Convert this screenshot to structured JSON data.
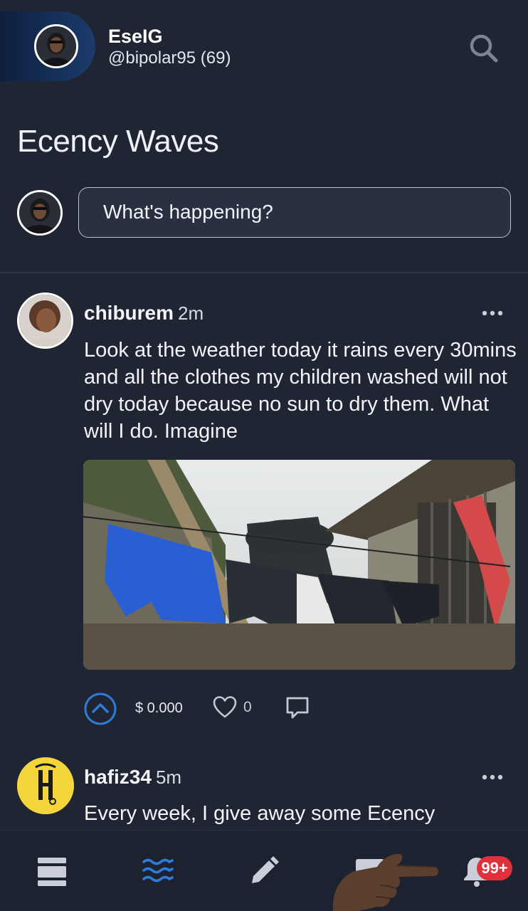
{
  "header": {
    "display_name": "EseIG",
    "handle": "@bipolar95 (69)"
  },
  "page_title": "Ecency Waves",
  "compose": {
    "placeholder": "What's happening?"
  },
  "posts": [
    {
      "author": "chiburem",
      "time": "2m",
      "body": "Look at the weather today it rains every 30mins and all the clothes my children washed will not dry today because no sun to dry them. What will I do. Imagine",
      "payout": "$ 0.000",
      "likes": "0"
    },
    {
      "author": "hafiz34",
      "time": "5m",
      "body": "Every week, I give away some Ecency"
    }
  ],
  "bottom_nav": {
    "items": [
      "feed-icon",
      "waves-icon",
      "create-post-icon",
      "messages-icon",
      "notifications-icon"
    ],
    "active": "waves-icon",
    "notification_badge": "99+"
  },
  "colors": {
    "background": "#1f2532",
    "accent": "#2f7bd8",
    "badge": "#e0303b"
  }
}
